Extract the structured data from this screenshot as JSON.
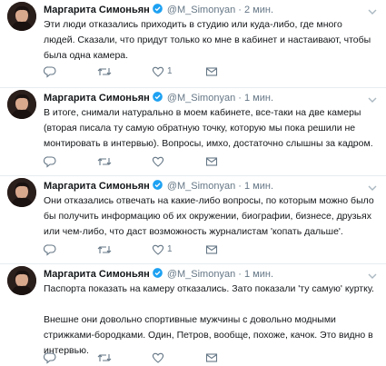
{
  "tweets": [
    {
      "author_name": "Маргарита Симоньян",
      "handle": "@M_Simonyan",
      "dot": "·",
      "time": "2 мин.",
      "text": "Эти люди отказались приходить в студию или куда-либо, где много людей. Сказали, что придут только ко мне в кабинет и настаивают, чтобы была одна камера.",
      "like_count": "1"
    },
    {
      "author_name": "Маргарита Симоньян",
      "handle": "@M_Simonyan",
      "dot": "·",
      "time": "1 мин.",
      "text": "В итоге, снимали натурально в моем кабинете, все-таки на две камеры (вторая писала ту самую обратную точку, которую мы пока решили не монтировать в интервью). Вопросы, имхо, достаточно слышны за кадром.",
      "like_count": ""
    },
    {
      "author_name": "Маргарита Симоньян",
      "handle": "@M_Simonyan",
      "dot": "·",
      "time": "1 мин.",
      "text": "Они отказались отвечать на какие-либо вопросы, по которым можно было бы получить информацию об их окружении, биографии, бизнесе, друзьях или чем-либо, что даст возможность журналистам 'копать дальше'.",
      "like_count": "1"
    },
    {
      "author_name": "Маргарита Симоньян",
      "handle": "@M_Simonyan",
      "dot": "·",
      "time": "1 мин.",
      "text": "Паспорта показать на камеру отказались. Зато показали 'ту самую' куртку.\n\nВнешне они довольно спортивные мужчины с довольно модными стрижками-бородками. Один, Петров, вообще, похоже, качок. Это видно в интервью.",
      "like_count": ""
    }
  ],
  "colors": {
    "text": "#14171a",
    "muted": "#657786",
    "verified": "#1da1f2",
    "divider": "#e6ecf0",
    "icon": "#657786"
  },
  "icons": [
    "avatar",
    "verified-badge-icon",
    "chevron-down-icon",
    "reply-icon",
    "retweet-icon",
    "like-icon",
    "direct-message-icon"
  ]
}
